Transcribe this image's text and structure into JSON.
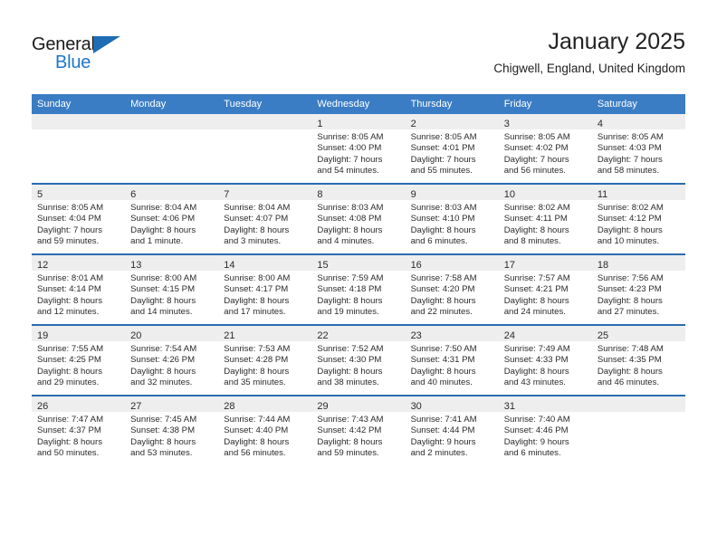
{
  "brand": {
    "name_top": "General",
    "name_bottom": "Blue",
    "accent_color": "#1f76c9"
  },
  "header": {
    "month_title": "January 2025",
    "location": "Chigwell, England, United Kingdom"
  },
  "calendar": {
    "header_background": "#3b7dc4",
    "row_divider_color": "#2a6cb0",
    "daynum_background": "#eeeeee",
    "weekday_headers": [
      "Sunday",
      "Monday",
      "Tuesday",
      "Wednesday",
      "Thursday",
      "Friday",
      "Saturday"
    ],
    "weeks": [
      [
        {
          "day": "",
          "sunrise": "",
          "sunset": "",
          "daylight_line1": "",
          "daylight_line2": ""
        },
        {
          "day": "",
          "sunrise": "",
          "sunset": "",
          "daylight_line1": "",
          "daylight_line2": ""
        },
        {
          "day": "",
          "sunrise": "",
          "sunset": "",
          "daylight_line1": "",
          "daylight_line2": ""
        },
        {
          "day": "1",
          "sunrise": "Sunrise: 8:05 AM",
          "sunset": "Sunset: 4:00 PM",
          "daylight_line1": "Daylight: 7 hours",
          "daylight_line2": "and 54 minutes."
        },
        {
          "day": "2",
          "sunrise": "Sunrise: 8:05 AM",
          "sunset": "Sunset: 4:01 PM",
          "daylight_line1": "Daylight: 7 hours",
          "daylight_line2": "and 55 minutes."
        },
        {
          "day": "3",
          "sunrise": "Sunrise: 8:05 AM",
          "sunset": "Sunset: 4:02 PM",
          "daylight_line1": "Daylight: 7 hours",
          "daylight_line2": "and 56 minutes."
        },
        {
          "day": "4",
          "sunrise": "Sunrise: 8:05 AM",
          "sunset": "Sunset: 4:03 PM",
          "daylight_line1": "Daylight: 7 hours",
          "daylight_line2": "and 58 minutes."
        }
      ],
      [
        {
          "day": "5",
          "sunrise": "Sunrise: 8:05 AM",
          "sunset": "Sunset: 4:04 PM",
          "daylight_line1": "Daylight: 7 hours",
          "daylight_line2": "and 59 minutes."
        },
        {
          "day": "6",
          "sunrise": "Sunrise: 8:04 AM",
          "sunset": "Sunset: 4:06 PM",
          "daylight_line1": "Daylight: 8 hours",
          "daylight_line2": "and 1 minute."
        },
        {
          "day": "7",
          "sunrise": "Sunrise: 8:04 AM",
          "sunset": "Sunset: 4:07 PM",
          "daylight_line1": "Daylight: 8 hours",
          "daylight_line2": "and 3 minutes."
        },
        {
          "day": "8",
          "sunrise": "Sunrise: 8:03 AM",
          "sunset": "Sunset: 4:08 PM",
          "daylight_line1": "Daylight: 8 hours",
          "daylight_line2": "and 4 minutes."
        },
        {
          "day": "9",
          "sunrise": "Sunrise: 8:03 AM",
          "sunset": "Sunset: 4:10 PM",
          "daylight_line1": "Daylight: 8 hours",
          "daylight_line2": "and 6 minutes."
        },
        {
          "day": "10",
          "sunrise": "Sunrise: 8:02 AM",
          "sunset": "Sunset: 4:11 PM",
          "daylight_line1": "Daylight: 8 hours",
          "daylight_line2": "and 8 minutes."
        },
        {
          "day": "11",
          "sunrise": "Sunrise: 8:02 AM",
          "sunset": "Sunset: 4:12 PM",
          "daylight_line1": "Daylight: 8 hours",
          "daylight_line2": "and 10 minutes."
        }
      ],
      [
        {
          "day": "12",
          "sunrise": "Sunrise: 8:01 AM",
          "sunset": "Sunset: 4:14 PM",
          "daylight_line1": "Daylight: 8 hours",
          "daylight_line2": "and 12 minutes."
        },
        {
          "day": "13",
          "sunrise": "Sunrise: 8:00 AM",
          "sunset": "Sunset: 4:15 PM",
          "daylight_line1": "Daylight: 8 hours",
          "daylight_line2": "and 14 minutes."
        },
        {
          "day": "14",
          "sunrise": "Sunrise: 8:00 AM",
          "sunset": "Sunset: 4:17 PM",
          "daylight_line1": "Daylight: 8 hours",
          "daylight_line2": "and 17 minutes."
        },
        {
          "day": "15",
          "sunrise": "Sunrise: 7:59 AM",
          "sunset": "Sunset: 4:18 PM",
          "daylight_line1": "Daylight: 8 hours",
          "daylight_line2": "and 19 minutes."
        },
        {
          "day": "16",
          "sunrise": "Sunrise: 7:58 AM",
          "sunset": "Sunset: 4:20 PM",
          "daylight_line1": "Daylight: 8 hours",
          "daylight_line2": "and 22 minutes."
        },
        {
          "day": "17",
          "sunrise": "Sunrise: 7:57 AM",
          "sunset": "Sunset: 4:21 PM",
          "daylight_line1": "Daylight: 8 hours",
          "daylight_line2": "and 24 minutes."
        },
        {
          "day": "18",
          "sunrise": "Sunrise: 7:56 AM",
          "sunset": "Sunset: 4:23 PM",
          "daylight_line1": "Daylight: 8 hours",
          "daylight_line2": "and 27 minutes."
        }
      ],
      [
        {
          "day": "19",
          "sunrise": "Sunrise: 7:55 AM",
          "sunset": "Sunset: 4:25 PM",
          "daylight_line1": "Daylight: 8 hours",
          "daylight_line2": "and 29 minutes."
        },
        {
          "day": "20",
          "sunrise": "Sunrise: 7:54 AM",
          "sunset": "Sunset: 4:26 PM",
          "daylight_line1": "Daylight: 8 hours",
          "daylight_line2": "and 32 minutes."
        },
        {
          "day": "21",
          "sunrise": "Sunrise: 7:53 AM",
          "sunset": "Sunset: 4:28 PM",
          "daylight_line1": "Daylight: 8 hours",
          "daylight_line2": "and 35 minutes."
        },
        {
          "day": "22",
          "sunrise": "Sunrise: 7:52 AM",
          "sunset": "Sunset: 4:30 PM",
          "daylight_line1": "Daylight: 8 hours",
          "daylight_line2": "and 38 minutes."
        },
        {
          "day": "23",
          "sunrise": "Sunrise: 7:50 AM",
          "sunset": "Sunset: 4:31 PM",
          "daylight_line1": "Daylight: 8 hours",
          "daylight_line2": "and 40 minutes."
        },
        {
          "day": "24",
          "sunrise": "Sunrise: 7:49 AM",
          "sunset": "Sunset: 4:33 PM",
          "daylight_line1": "Daylight: 8 hours",
          "daylight_line2": "and 43 minutes."
        },
        {
          "day": "25",
          "sunrise": "Sunrise: 7:48 AM",
          "sunset": "Sunset: 4:35 PM",
          "daylight_line1": "Daylight: 8 hours",
          "daylight_line2": "and 46 minutes."
        }
      ],
      [
        {
          "day": "26",
          "sunrise": "Sunrise: 7:47 AM",
          "sunset": "Sunset: 4:37 PM",
          "daylight_line1": "Daylight: 8 hours",
          "daylight_line2": "and 50 minutes."
        },
        {
          "day": "27",
          "sunrise": "Sunrise: 7:45 AM",
          "sunset": "Sunset: 4:38 PM",
          "daylight_line1": "Daylight: 8 hours",
          "daylight_line2": "and 53 minutes."
        },
        {
          "day": "28",
          "sunrise": "Sunrise: 7:44 AM",
          "sunset": "Sunset: 4:40 PM",
          "daylight_line1": "Daylight: 8 hours",
          "daylight_line2": "and 56 minutes."
        },
        {
          "day": "29",
          "sunrise": "Sunrise: 7:43 AM",
          "sunset": "Sunset: 4:42 PM",
          "daylight_line1": "Daylight: 8 hours",
          "daylight_line2": "and 59 minutes."
        },
        {
          "day": "30",
          "sunrise": "Sunrise: 7:41 AM",
          "sunset": "Sunset: 4:44 PM",
          "daylight_line1": "Daylight: 9 hours",
          "daylight_line2": "and 2 minutes."
        },
        {
          "day": "31",
          "sunrise": "Sunrise: 7:40 AM",
          "sunset": "Sunset: 4:46 PM",
          "daylight_line1": "Daylight: 9 hours",
          "daylight_line2": "and 6 minutes."
        },
        {
          "day": "",
          "sunrise": "",
          "sunset": "",
          "daylight_line1": "",
          "daylight_line2": ""
        }
      ]
    ]
  }
}
